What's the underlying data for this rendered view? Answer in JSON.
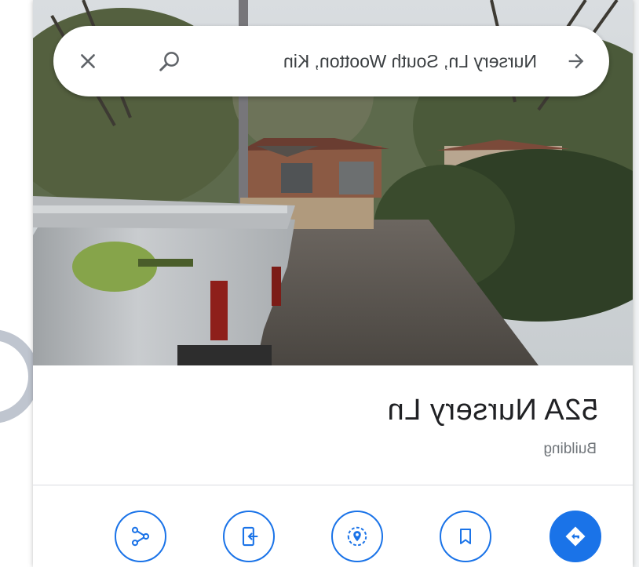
{
  "search": {
    "value": "Nursery Ln, South Wootton, Kin"
  },
  "place": {
    "title": "52A Nursery Ln",
    "category": "Building"
  },
  "actions": [
    {
      "icon": "directions-icon"
    },
    {
      "icon": "bookmark-icon"
    },
    {
      "icon": "nearby-icon"
    },
    {
      "icon": "send-to-phone-icon"
    },
    {
      "icon": "share-icon"
    }
  ],
  "colors": {
    "accent": "#1a73e8",
    "title": "#202124",
    "subtitle": "#70757a",
    "divider": "#dadce0"
  }
}
